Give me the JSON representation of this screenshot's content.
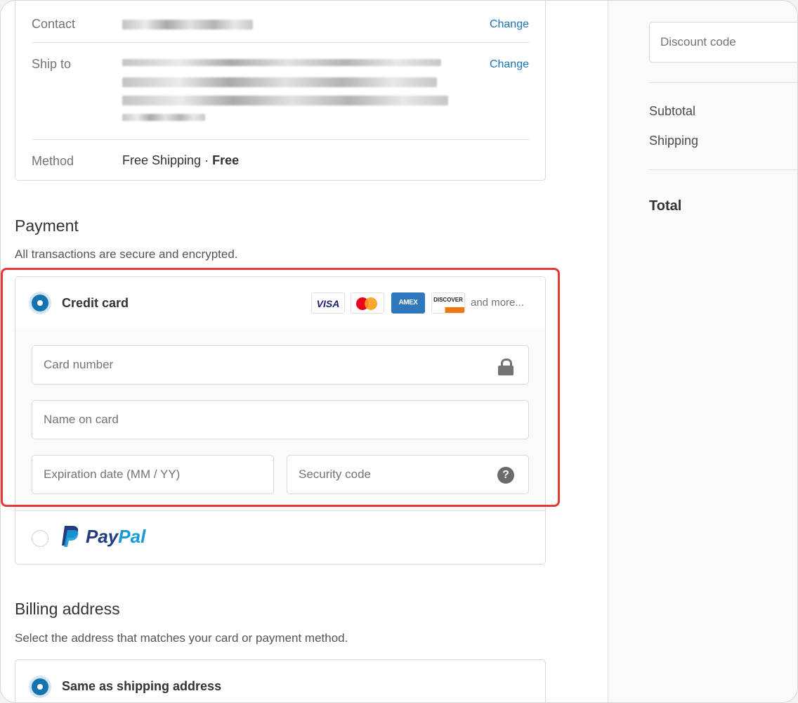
{
  "review": {
    "contact_label": "Contact",
    "ship_to_label": "Ship to",
    "method_label": "Method",
    "change_label": "Change",
    "method_value": "Free Shipping · ",
    "method_price": "Free"
  },
  "payment": {
    "heading": "Payment",
    "subtitle": "All transactions are secure and encrypted.",
    "credit_card_label": "Credit card",
    "brands": {
      "visa": "VISA",
      "amex": "AMEX",
      "discover": "DISCOVER"
    },
    "more_label": "and more...",
    "card_number_placeholder": "Card number",
    "name_on_card_placeholder": "Name on card",
    "expiration_placeholder": "Expiration date (MM / YY)",
    "security_code_placeholder": "Security code",
    "help_glyph": "?",
    "paypal_part1": "Pay",
    "paypal_part2": "Pal",
    "highlight_color": "#e53935"
  },
  "billing": {
    "heading": "Billing address",
    "subtitle": "Select the address that matches your card or payment method.",
    "same_as_shipping_label": "Same as shipping address"
  },
  "summary": {
    "discount_placeholder": "Discount code",
    "subtotal_label": "Subtotal",
    "shipping_label": "Shipping",
    "total_label": "Total"
  },
  "colors": {
    "accent": "#1773b0",
    "link": "#1a73b8"
  }
}
